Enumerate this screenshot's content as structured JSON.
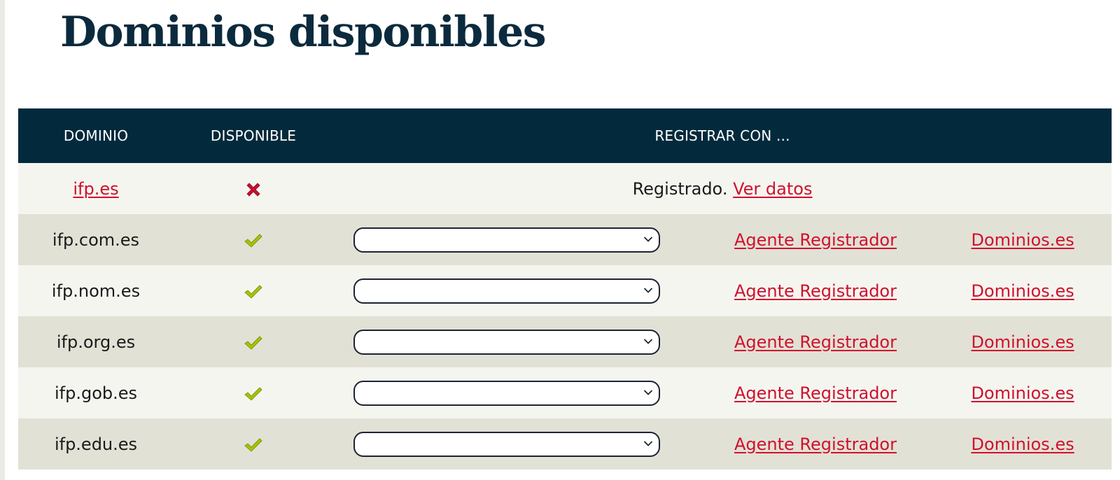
{
  "page": {
    "title": "Dominios disponibles"
  },
  "table": {
    "headers": {
      "dominio": "DOMINIO",
      "disponible": "DISPONIBLE",
      "registrar": "REGISTRAR CON ..."
    },
    "rows": [
      {
        "domain": "ifp.es",
        "domain_is_link": true,
        "available": false,
        "status_icon": "cross-icon",
        "registered_text": "Registrado.",
        "view_link": "Ver datos"
      },
      {
        "domain": "ifp.com.es",
        "available": true,
        "status_icon": "check-icon",
        "registrar_select_value": "",
        "agent_link": "Agente Registrador",
        "dominios_link": "Dominios.es"
      },
      {
        "domain": "ifp.nom.es",
        "available": true,
        "status_icon": "check-icon",
        "registrar_select_value": "",
        "agent_link": "Agente Registrador",
        "dominios_link": "Dominios.es"
      },
      {
        "domain": "ifp.org.es",
        "available": true,
        "status_icon": "check-icon",
        "registrar_select_value": "",
        "agent_link": "Agente Registrador",
        "dominios_link": "Dominios.es"
      },
      {
        "domain": "ifp.gob.es",
        "available": true,
        "status_icon": "check-icon",
        "registrar_select_value": "",
        "agent_link": "Agente Registrador",
        "dominios_link": "Dominios.es"
      },
      {
        "domain": "ifp.edu.es",
        "available": true,
        "status_icon": "check-icon",
        "registrar_select_value": "",
        "agent_link": "Agente Registrador",
        "dominios_link": "Dominios.es"
      }
    ]
  },
  "colors": {
    "header_bg": "#022a3c",
    "title": "#0b2a3d",
    "link": "#d0102c",
    "row_light": "#f5f5f0",
    "row_dark": "#e2e1d6",
    "check": "#a6c400",
    "cross": "#c8102e"
  }
}
